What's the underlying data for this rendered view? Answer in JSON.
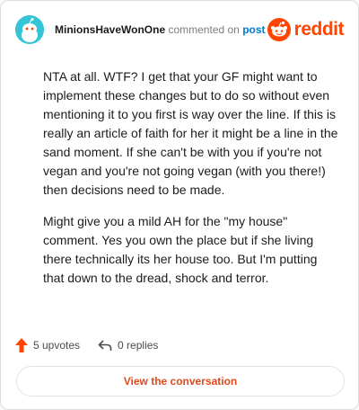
{
  "comment": {
    "username": "MinionsHaveWonOne",
    "action_text": "commented on",
    "post_link_text": "post",
    "paragraphs": [
      "NTA at all. WTF? I get that your GF might want to implement these changes but to do so without even mentioning it to you first is way over the line. If this is really an article of faith for her it might be a line in the sand moment. If she can't be with you if you're not vegan and you're not going vegan (with you there!) then decisions need to be made.",
      "Might give you a mild AH for the \"my house\" comment. Yes you own the place but if she living there technically its her house too. But I'm putting that down to the dread, shock and terror."
    ],
    "upvotes": "5 upvotes",
    "replies": "0 replies"
  },
  "brand": {
    "logo_text": "reddit",
    "accent": "#ff4500"
  },
  "cta": {
    "label": "View the conversation"
  },
  "icons": {
    "avatar": "snoo-avatar-icon",
    "logo": "reddit-snoo-icon",
    "upvote": "upvote-arrow-icon",
    "reply": "reply-arrow-icon"
  }
}
